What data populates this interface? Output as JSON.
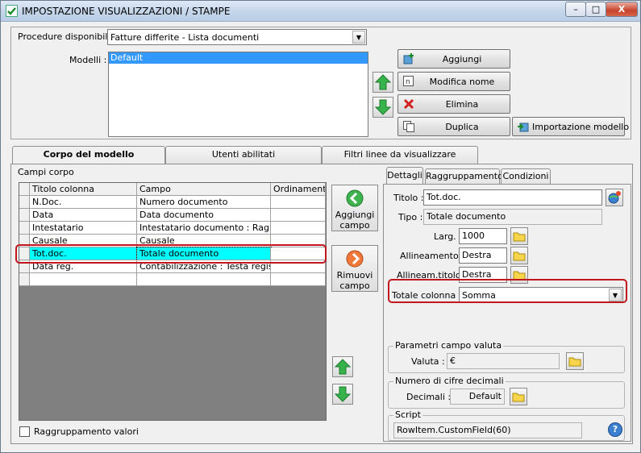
{
  "window": {
    "title": "IMPOSTAZIONE VISUALIZZAZIONI / STAMPE",
    "min_label": "–",
    "max_label": "□",
    "close_label": "X"
  },
  "top": {
    "procedure_label": "Procedure disponibili :",
    "procedure_value": "Fatture differite - Lista documenti",
    "modelli_label": "Modelli :",
    "modelli_items": [
      "Default"
    ],
    "buttons": {
      "aggiungi": "Aggiungi",
      "modifica": "Modifica nome",
      "elimina": "Elimina",
      "duplica": "Duplica",
      "importazione": "Importazione modello"
    }
  },
  "main_tabs": [
    "Corpo del modello",
    "Utenti abilitati",
    "Filtri linee da visualizzare"
  ],
  "campi_corpo": {
    "label": "Campi corpo",
    "columns": [
      "Titolo colonna",
      "Campo",
      "Ordinamento"
    ],
    "rows": [
      {
        "titolo": "N.Doc.",
        "campo": "Numero documento",
        "ord": ""
      },
      {
        "titolo": "Data",
        "campo": "Data documento",
        "ord": ""
      },
      {
        "titolo": "Intestatario",
        "campo": "Intestatario documento : Ragion...",
        "ord": ""
      },
      {
        "titolo": "Causale",
        "campo": "Causale",
        "ord": ""
      },
      {
        "titolo": "Tot.doc.",
        "campo": "Totale documento",
        "ord": ""
      },
      {
        "titolo": "Data reg.",
        "campo": "Contabilizzazione : Testa registr...",
        "ord": ""
      },
      {
        "titolo": "",
        "campo": "",
        "ord": ""
      }
    ],
    "selected_row": 4,
    "aggiungi_campo": [
      "Aggiungi",
      "campo"
    ],
    "rimuovi_campo": [
      "Rimuovi",
      "campo"
    ],
    "raggruppamento_label": "Raggruppamento valori",
    "raggruppamento_checked": false
  },
  "detail_tabs": [
    "Dettagli",
    "Raggruppamento",
    "Condizioni"
  ],
  "dettagli": {
    "titolo_label": "Titolo :",
    "titolo_value": "Tot.doc.",
    "tipo_label": "Tipo :",
    "tipo_value": "Totale documento",
    "larg_label": "Larg. :",
    "larg_value": "1000",
    "allineamento_label": "Allineamento :",
    "allineamento_value": "Destra",
    "allineam_titolo_label": "Allineam.titolo :",
    "allineam_titolo_value": "Destra",
    "totale_colonna_label": "Totale colonna :",
    "totale_colonna_value": "Somma",
    "parametri_group": "Parametri campo valuta",
    "valuta_label": "Valuta :",
    "valuta_value": "€",
    "decimali_group": "Numero di cifre decimali",
    "decimali_label": "Decimali :",
    "decimali_value": "Default",
    "script_group": "Script",
    "script_value": "RowItem.CustomField(60)"
  },
  "colors": {
    "selected_row": "#00ffff",
    "highlight": "#c0181e",
    "titlebar": "#c6d7eb"
  }
}
